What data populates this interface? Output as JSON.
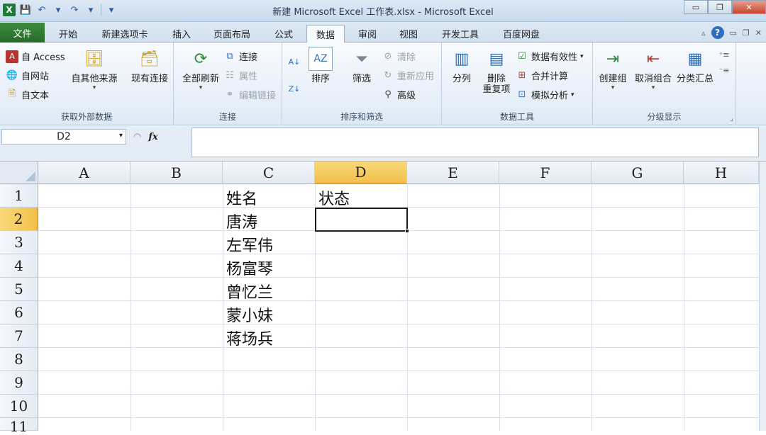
{
  "window": {
    "title": "新建 Microsoft Excel 工作表.xlsx  -  Microsoft Excel",
    "logo": "X",
    "minimize": "▭",
    "restore": "❐",
    "close": "✕"
  },
  "qat": {
    "save_icon": "💾",
    "undo_icon": "↶",
    "redo_icon": "↷",
    "dropdown": "▾"
  },
  "tabs": {
    "file": "文件",
    "items": [
      "开始",
      "新建选项卡",
      "插入",
      "页面布局",
      "公式",
      "数据",
      "审阅",
      "视图",
      "开发工具",
      "百度网盘"
    ],
    "active": "数据",
    "help": "?"
  },
  "ribbon": {
    "external_data": {
      "label": "获取外部数据",
      "access": "自 Access",
      "web": "自网站",
      "text": "自文本",
      "other_sources": "自其他来源",
      "existing": "现有连接"
    },
    "connections": {
      "label": "连接",
      "refresh_all": "全部刷新",
      "connections": "连接",
      "properties": "属性",
      "edit_links": "编辑链接"
    },
    "sort_filter": {
      "label": "排序和筛选",
      "sort": "排序",
      "filter": "筛选",
      "clear": "清除",
      "reapply": "重新应用",
      "advanced": "高级"
    },
    "data_tools": {
      "label": "数据工具",
      "text_to_columns": "分列",
      "remove_duplicates_1": "删除",
      "remove_duplicates_2": "重复项",
      "data_validation": "数据有效性",
      "consolidate": "合并计算",
      "what_if": "模拟分析"
    },
    "outline": {
      "label": "分级显示",
      "group": "创建组",
      "ungroup": "取消组合",
      "subtotal": "分类汇总"
    }
  },
  "formula_bar": {
    "name_box": "D2",
    "fx": "fx",
    "formula": ""
  },
  "grid": {
    "columns": [
      "A",
      "B",
      "C",
      "D",
      "E",
      "F",
      "G",
      "H"
    ],
    "selected_column": "D",
    "rows": [
      "1",
      "2",
      "3",
      "4",
      "5",
      "6",
      "7",
      "8",
      "9",
      "10",
      "11"
    ],
    "selected_row": "2",
    "cells": {
      "C1": "姓名",
      "D1": "状态",
      "C2": "唐涛",
      "C3": "左军伟",
      "C4": "杨富琴",
      "C5": "曾忆兰",
      "C6": "蒙小妹",
      "C7": "蒋场兵"
    }
  }
}
